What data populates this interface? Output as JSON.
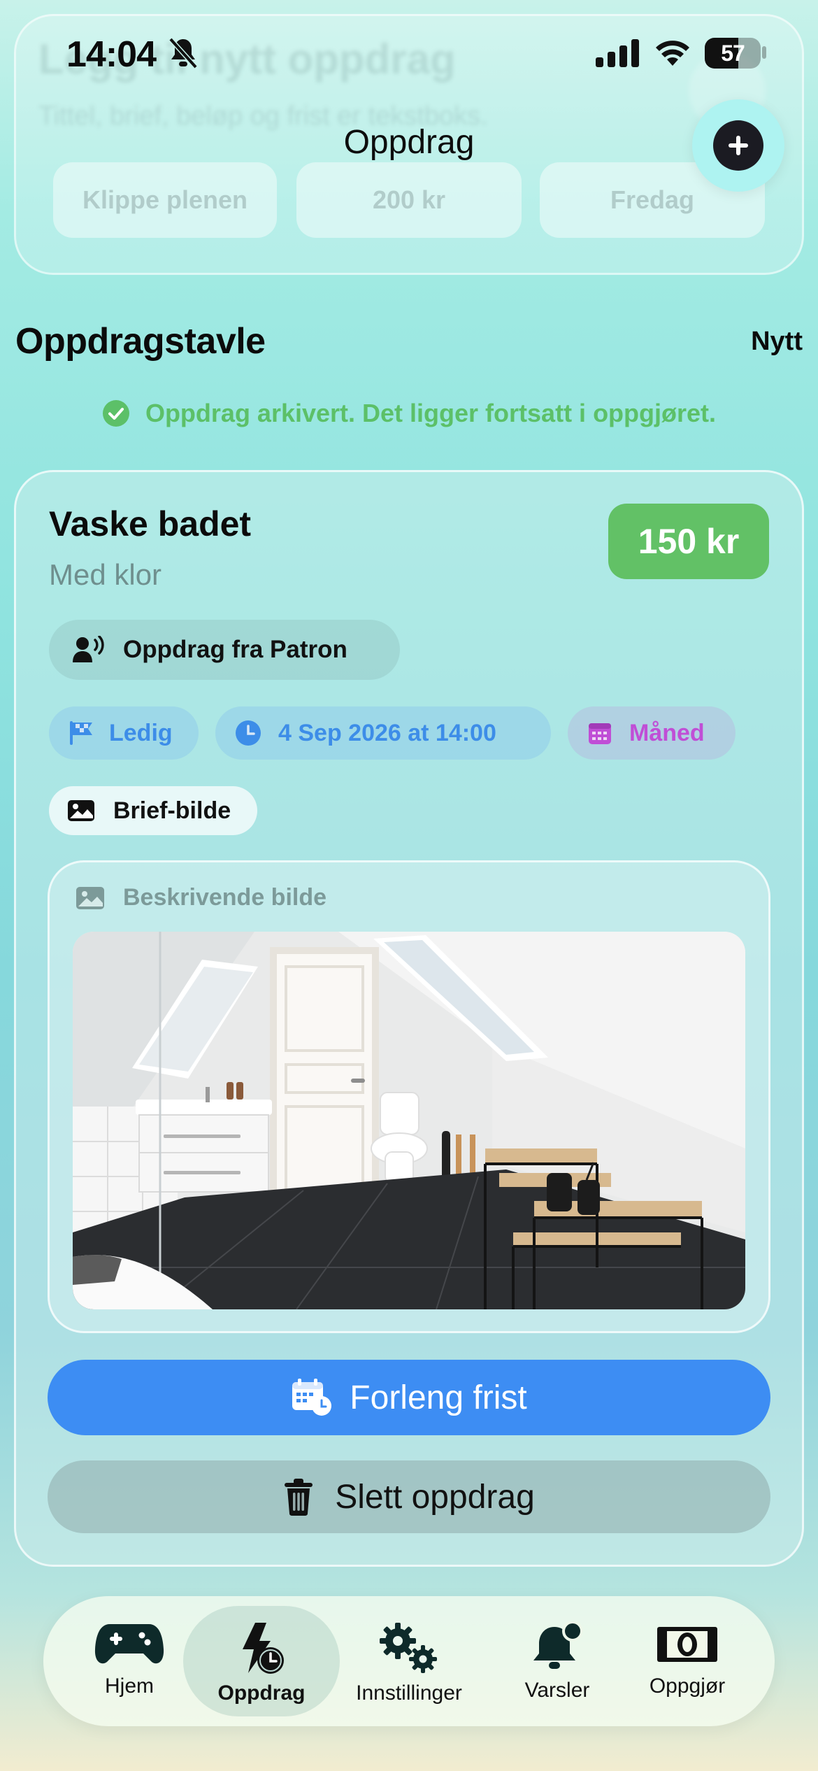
{
  "status_bar": {
    "time": "14:04",
    "battery": "57"
  },
  "composer": {
    "title": "Legg til nytt oppdrag",
    "subtitle": "Tittel, brief, beløp og frist er tekstboks.",
    "chips": [
      "Klippe plenen",
      "200 kr",
      "Fredag"
    ]
  },
  "header": {
    "title": "Oppdrag",
    "add_icon": "plus-icon"
  },
  "board": {
    "title": "Oppdragstavle",
    "new_label": "Nytt",
    "toast": "Oppdrag arkivert. Det ligger fortsatt i oppgjøret."
  },
  "task": {
    "title": "Vaske badet",
    "description": "Med klor",
    "price": "150 kr",
    "from": "Oppdrag fra Patron",
    "status": "Ledig",
    "deadline": "4 Sep 2026 at 14:00",
    "period": "Måned",
    "brief_label": "Brief-bilde",
    "image_label": "Beskrivende bilde",
    "extend_button": "Forleng frist",
    "delete_button": "Slett oppdrag"
  },
  "colors": {
    "price_green": "#62c166",
    "primary_blue": "#3d8df3",
    "status_blue": "#3d8de8",
    "period_purple": "#c04ed6",
    "toast_green": "#5cc068"
  },
  "tabs": [
    {
      "label": "Hjem",
      "icon": "gamepad-icon"
    },
    {
      "label": "Oppdrag",
      "icon": "task-timer-icon"
    },
    {
      "label": "Innstillinger",
      "icon": "gears-icon"
    },
    {
      "label": "Varsler",
      "icon": "bell-icon"
    },
    {
      "label": "Oppgjør",
      "icon": "banknote-icon"
    }
  ]
}
